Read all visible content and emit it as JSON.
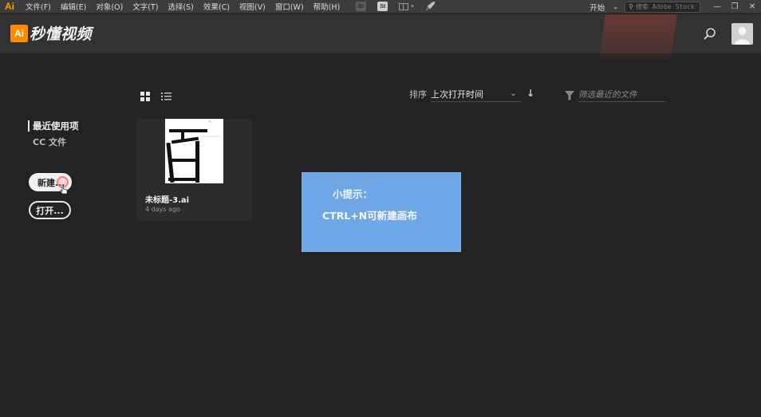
{
  "menubar": {
    "app_logo": "Ai",
    "menus": [
      "文件(F)",
      "编辑(E)",
      "对象(O)",
      "文字(T)",
      "选择(S)",
      "效果(C)",
      "视图(V)",
      "窗口(W)",
      "帮助(H)"
    ],
    "bridge_icon": "Br",
    "stock_icon": "St",
    "workspace_label": "开始",
    "stock_search_placeholder": "搜索 Adobe Stock"
  },
  "header": {
    "brand_badge": "Ai",
    "brand_text": "秒懂视频"
  },
  "toolbar": {
    "sort_label": "排序",
    "sort_value": "上次打开时间",
    "filter_placeholder": "筛选最近的文件"
  },
  "nav": {
    "recent_label": "最近使用项",
    "cc_files_label": "CC 文件",
    "new_button": "新建...",
    "open_button": "打开..."
  },
  "files": [
    {
      "name": "未标题-3.ai",
      "date": "4 days ago"
    }
  ],
  "tip": {
    "title": "小提示：",
    "body": "CTRL+N可新建画布"
  },
  "colors": {
    "accent_orange": "#ff8a00",
    "tip_blue": "#6fa7e6",
    "background": "#232323"
  }
}
